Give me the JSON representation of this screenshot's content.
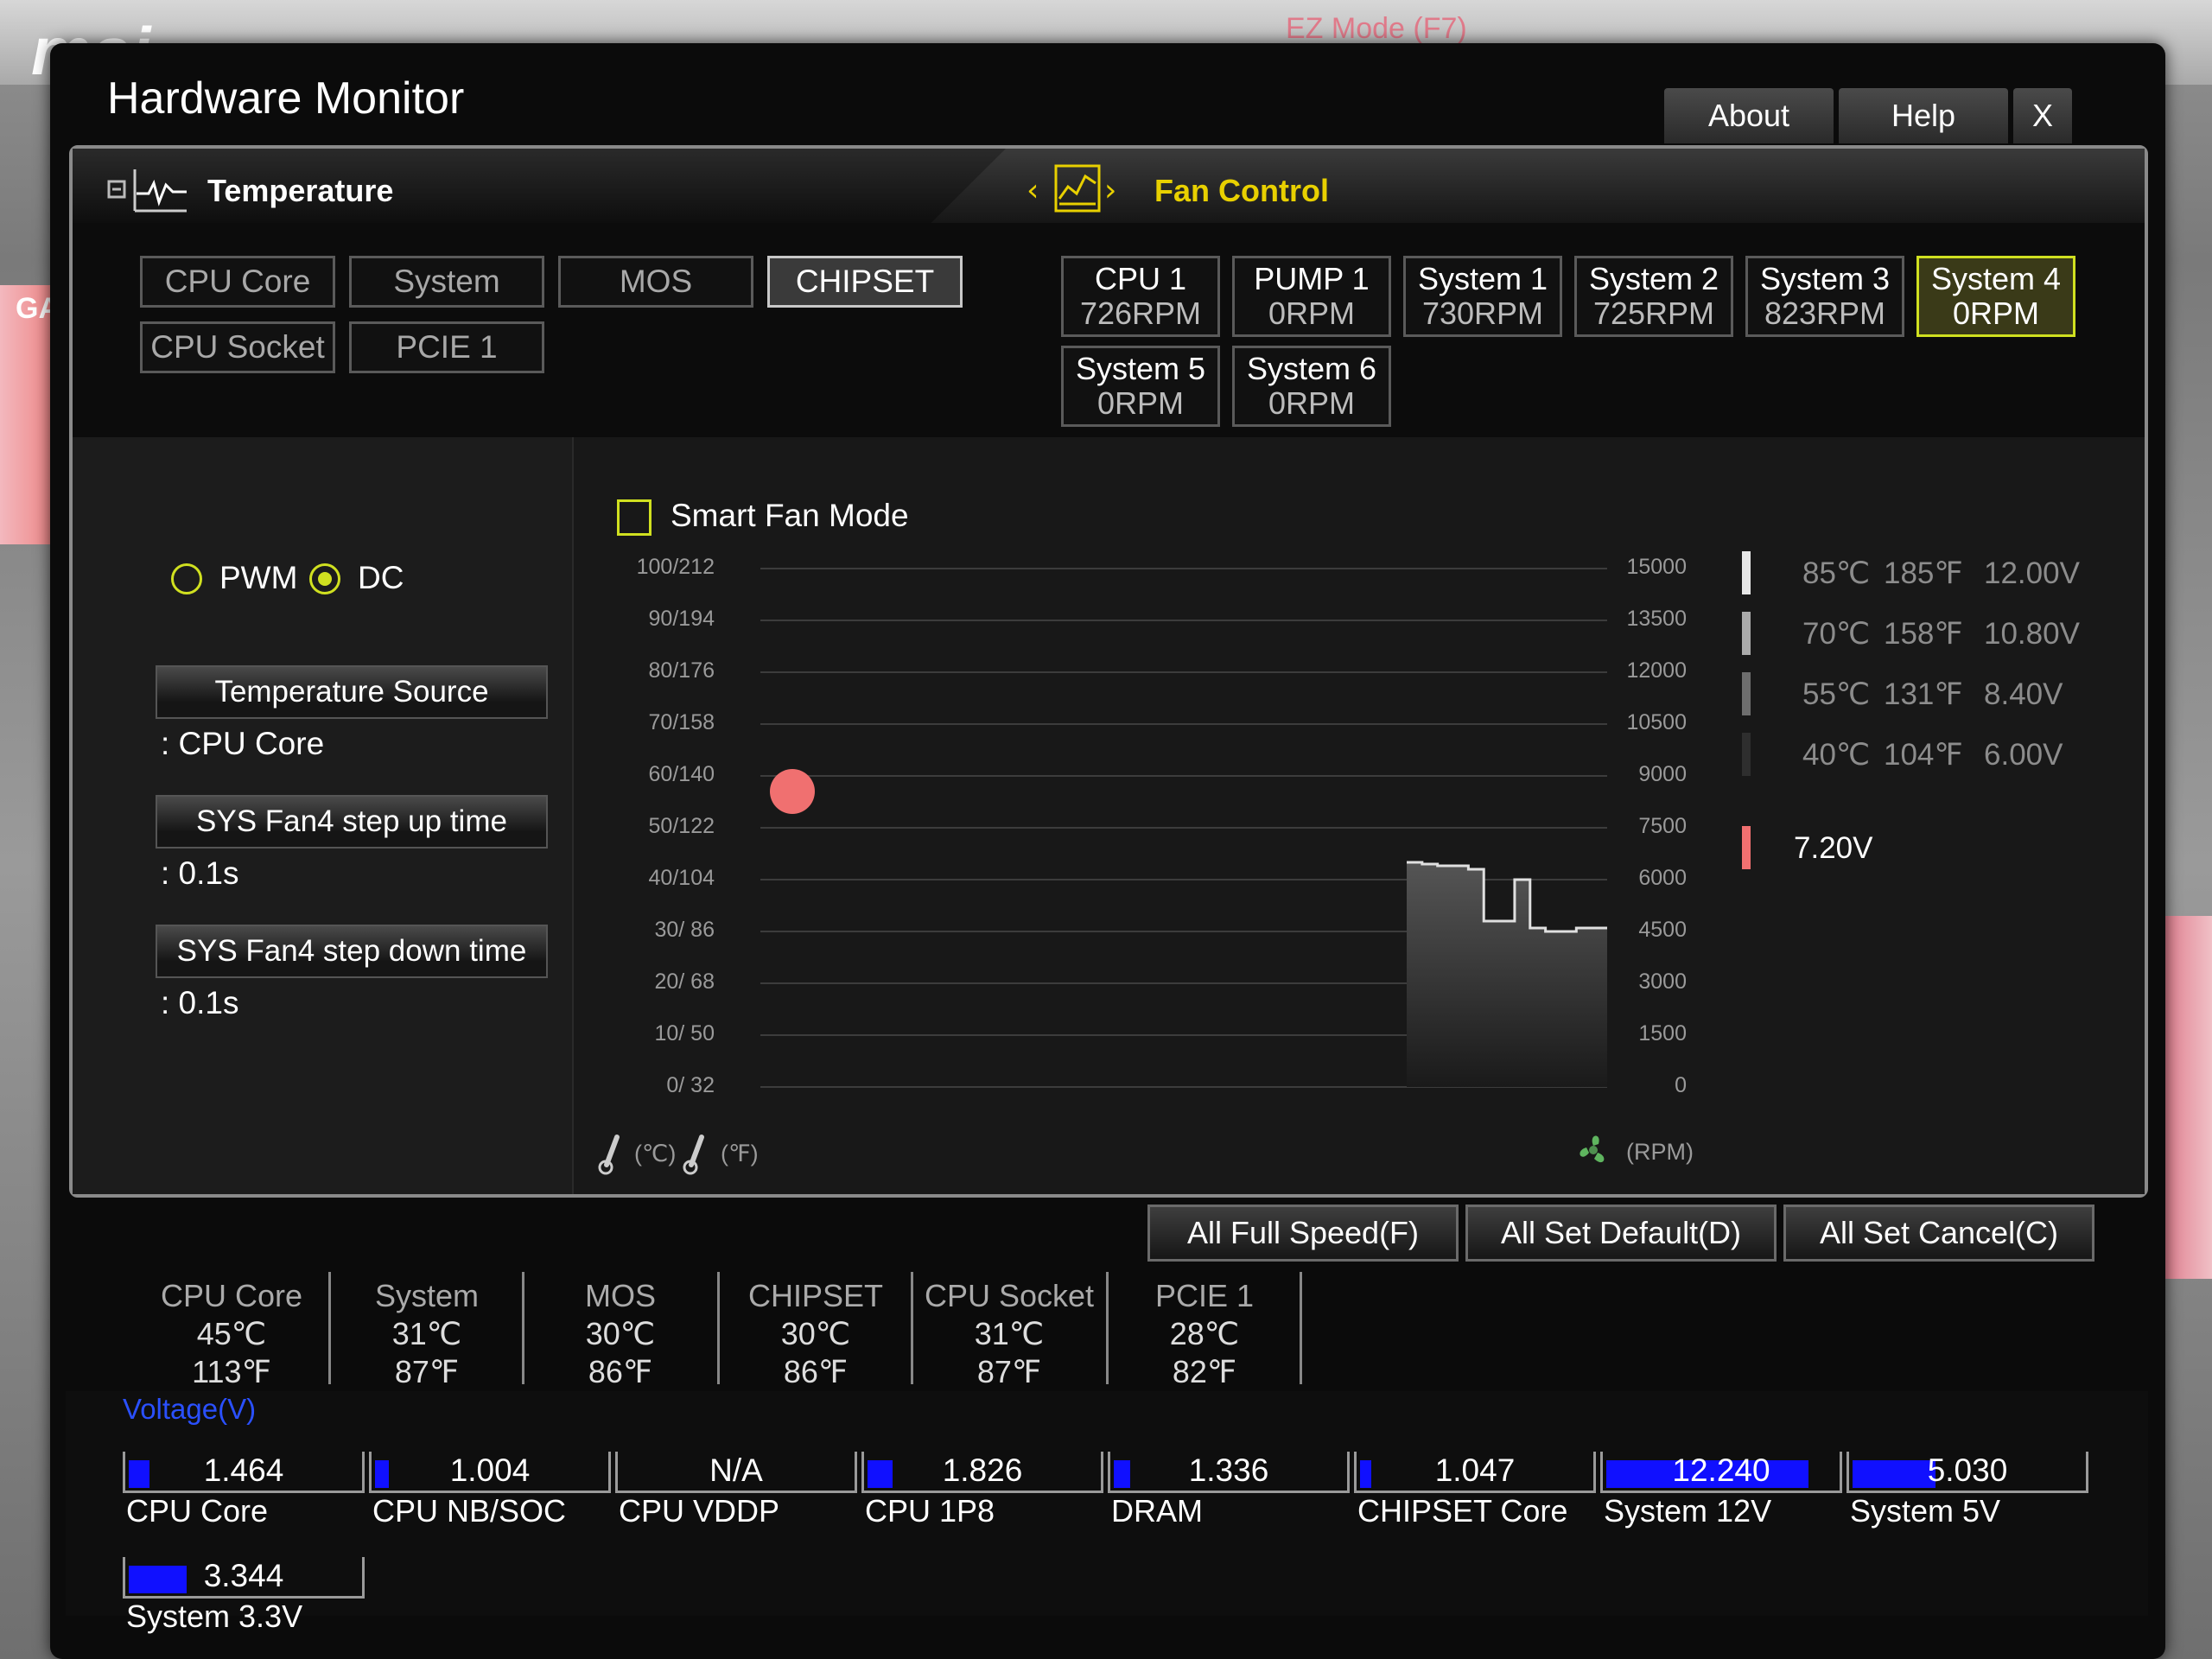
{
  "background": {
    "logo": "msi",
    "ez_mode": "EZ Mode (F7)",
    "side_tag": "GA"
  },
  "window": {
    "title": "Hardware Monitor",
    "buttons": {
      "about": "About",
      "help": "Help",
      "close": "X"
    }
  },
  "tabs": {
    "temperature": "Temperature",
    "fan_control": "Fan Control"
  },
  "temp_sources": [
    "CPU Core",
    "System",
    "MOS",
    "CHIPSET",
    "CPU Socket",
    "PCIE 1"
  ],
  "temp_selected": "CHIPSET",
  "fans": [
    {
      "name": "CPU 1",
      "rpm": "726RPM"
    },
    {
      "name": "PUMP 1",
      "rpm": "0RPM"
    },
    {
      "name": "System 1",
      "rpm": "730RPM"
    },
    {
      "name": "System 2",
      "rpm": "725RPM"
    },
    {
      "name": "System 3",
      "rpm": "823RPM"
    },
    {
      "name": "System 4",
      "rpm": "0RPM"
    },
    {
      "name": "System 5",
      "rpm": "0RPM"
    },
    {
      "name": "System 6",
      "rpm": "0RPM"
    }
  ],
  "fan_selected": "System 4",
  "fan_settings": {
    "mode_pwm": "PWM",
    "mode_dc": "DC",
    "mode_selected": "DC",
    "temperature_source_label": "Temperature Source",
    "temperature_source_value": ": CPU Core",
    "step_up_label": "SYS Fan4 step up time",
    "step_up_value": ": 0.1s",
    "step_down_label": "SYS Fan4 step down time",
    "step_down_value": ": 0.1s"
  },
  "smart_fan": {
    "label": "Smart Fan Mode",
    "checked": false
  },
  "chart": {
    "left_ticks": [
      "100/212",
      "90/194",
      "80/176",
      "70/158",
      "60/140",
      "50/122",
      "40/104",
      "30/  86",
      "20/  68",
      "10/  50",
      "0/  32"
    ],
    "right_ticks": [
      "15000",
      "13500",
      "12000",
      "10500",
      "9000",
      "7500",
      "6000",
      "4500",
      "3000",
      "1500",
      "0"
    ],
    "celsius_label": "(℃)",
    "fahrenheit_label": "(℉)",
    "rpm_label": "(RPM)",
    "current_temp_c": 57,
    "rpm_history": [
      6500,
      6450,
      6400,
      6400,
      6300,
      4800,
      4800,
      6000,
      4600,
      4500,
      4500,
      4600,
      4600,
      4600
    ]
  },
  "legend": [
    {
      "c": "85℃",
      "f": "185℉",
      "v": "12.00V",
      "color": "#e6e6e6"
    },
    {
      "c": "70℃",
      "f": "158℉",
      "v": "10.80V",
      "color": "#aaaaaa"
    },
    {
      "c": "55℃",
      "f": "131℉",
      "v": "8.40V",
      "color": "#6e6e6e"
    },
    {
      "c": "40℃",
      "f": "104℉",
      "v": "6.00V",
      "color": "#2e2e2e"
    }
  ],
  "current_voltage": {
    "value": "7.20V",
    "color": "#f07070"
  },
  "actions": {
    "full_speed": "All Full Speed(F)",
    "set_default": "All Set Default(D)",
    "set_cancel": "All Set Cancel(C)"
  },
  "temps": [
    {
      "name": "CPU Core",
      "c": "45℃",
      "f": "113℉"
    },
    {
      "name": "System",
      "c": "31℃",
      "f": "87℉"
    },
    {
      "name": "MOS",
      "c": "30℃",
      "f": "86℉"
    },
    {
      "name": "CHIPSET",
      "c": "30℃",
      "f": "86℉"
    },
    {
      "name": "CPU Socket",
      "c": "31℃",
      "f": "87℉"
    },
    {
      "name": "PCIE 1",
      "c": "28℃",
      "f": "82℉"
    }
  ],
  "voltage_title": "Voltage(V)",
  "voltages": [
    {
      "name": "CPU Core",
      "value": "1.464",
      "fill": 0.09
    },
    {
      "name": "CPU NB/SOC",
      "value": "1.004",
      "fill": 0.06
    },
    {
      "name": "CPU VDDP",
      "value": "N/A",
      "fill": 0.0
    },
    {
      "name": "CPU 1P8",
      "value": "1.826",
      "fill": 0.11
    },
    {
      "name": "DRAM",
      "value": "1.336",
      "fill": 0.07
    },
    {
      "name": "CHIPSET Core",
      "value": "1.047",
      "fill": 0.05
    },
    {
      "name": "System 12V",
      "value": "12.240",
      "fill": 0.88
    },
    {
      "name": "System 5V",
      "value": "5.030",
      "fill": 0.36
    },
    {
      "name": "System 3.3V",
      "value": "3.344",
      "fill": 0.25
    }
  ],
  "colors": {
    "accent": "#d0e020",
    "bar": "#1010ff",
    "point": "#f07070"
  }
}
